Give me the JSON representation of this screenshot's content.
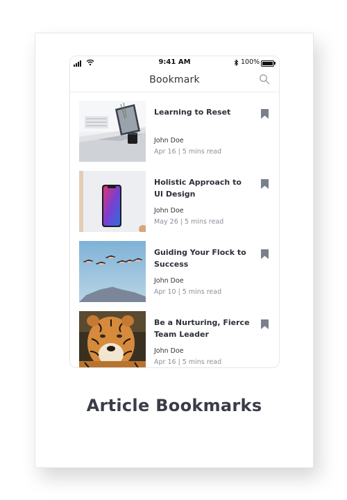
{
  "status_bar": {
    "time": "9:41 AM",
    "battery_percent": "100%",
    "battery_level": 1.0,
    "bluetooth_glyph": "✱"
  },
  "header": {
    "title": "Bookmark",
    "search_icon": "search-icon"
  },
  "articles": [
    {
      "title": "Learning to Reset",
      "author": "John Doe",
      "meta": "Apr 16 | 5 mins read",
      "thumbnail": "laptop-desk-image",
      "bookmarked": true
    },
    {
      "title": "Holistic Approach to UI Design",
      "author": "John Doe",
      "meta": "May 26 | 5 mins read",
      "thumbnail": "smartphone-image",
      "bookmarked": true
    },
    {
      "title": "Guiding Your Flock to Success",
      "author": "John Doe",
      "meta": "Apr 10 | 5 mins read",
      "thumbnail": "flamingos-flying-image",
      "bookmarked": true
    },
    {
      "title": "Be a Nurturing, Fierce Team Leader",
      "author": "John Doe",
      "meta": "Apr 16 | 5 mins read",
      "thumbnail": "tiger-image",
      "bookmarked": true
    }
  ],
  "caption": "Article Bookmarks",
  "colors": {
    "bookmark": "#7a7f8c",
    "title_text": "#2d2f3a",
    "meta_text": "#8a8f99",
    "caption_text": "#3a3d47"
  }
}
